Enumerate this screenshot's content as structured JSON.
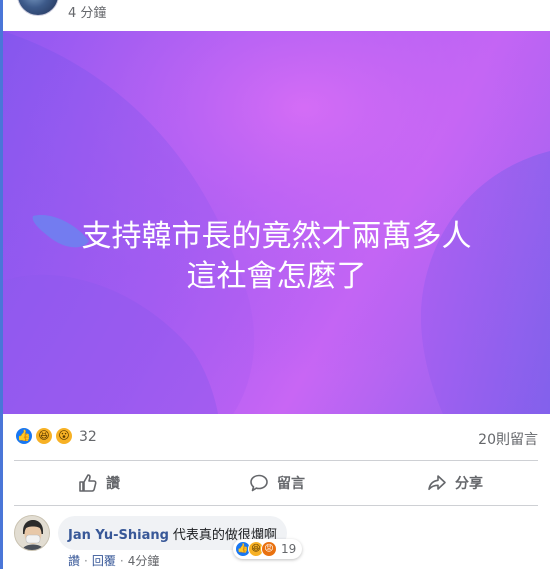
{
  "header": {
    "time": "4 分鐘"
  },
  "post": {
    "text_line1": "支持韓市長的竟然才兩萬多人",
    "text_line2": "這社會怎麼了"
  },
  "reactions": {
    "icons": [
      "like-icon",
      "haha-icon",
      "wow-icon"
    ],
    "count": "32",
    "comments_count": "20則留言"
  },
  "actions": {
    "like": "讚",
    "comment": "留言",
    "share": "分享"
  },
  "comment": {
    "author": "Jan Yu-Shiang",
    "text": "代表真的做很爛啊",
    "reaction_count": "19",
    "like_link": "讚",
    "reply_link": "回覆",
    "time": "4分鐘"
  },
  "colors": {
    "accent": "#4a76d8",
    "like_blue": "#1877f2",
    "name_blue": "#385898",
    "bg_gradient_start": "#8a57f0",
    "bg_gradient_mid": "#c866f4"
  }
}
